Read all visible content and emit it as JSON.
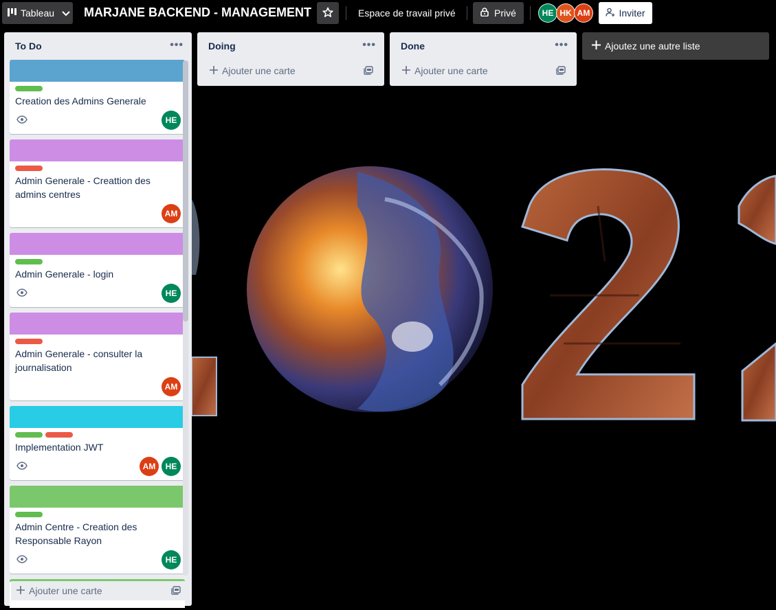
{
  "colors": {
    "avatar_he": "#00875a",
    "avatar_hk": "#e0541c",
    "avatar_am": "#dc3f14",
    "label_green": "#61bd4f",
    "label_red": "#eb5a46",
    "cover_blue": "#5ba4cf",
    "cover_purple": "#cd8de5",
    "cover_sky": "#29cce5",
    "cover_green": "#7bc86c"
  },
  "header": {
    "board_switcher_label": "Tableau",
    "board_title": "MARJANE BACKEND - MANAGEMENT",
    "workspace_label": "Espace de travail privé",
    "visibility_label": "Privé",
    "members": [
      "HE",
      "HK",
      "AM"
    ],
    "invite_label": "Inviter"
  },
  "lists": [
    {
      "title": "To Do",
      "add_card_label": "Ajouter une carte",
      "cards": [
        {
          "cover": "cover_blue",
          "labels": [
            "label_green"
          ],
          "title": "Creation des Admins Generale",
          "watch": true,
          "members": [
            "HE"
          ]
        },
        {
          "cover": "cover_purple",
          "labels": [
            "label_red"
          ],
          "title": "Admin Generale - Creattion des admins centres",
          "watch": false,
          "members": [
            "AM"
          ]
        },
        {
          "cover": "cover_purple",
          "labels": [
            "label_green"
          ],
          "title": "Admin Generale - login",
          "watch": true,
          "members": [
            "HE"
          ]
        },
        {
          "cover": "cover_purple",
          "labels": [
            "label_red"
          ],
          "title": "Admin Generale - consulter la journalisation",
          "watch": false,
          "members": [
            "AM"
          ]
        },
        {
          "cover": "cover_sky",
          "labels": [
            "label_green",
            "label_red"
          ],
          "title": "Implementation JWT",
          "watch": true,
          "members": [
            "AM",
            "HE"
          ]
        },
        {
          "cover": "cover_green",
          "labels": [
            "label_green"
          ],
          "title": "Admin Centre - Creation des Responsable Rayon",
          "watch": true,
          "members": [
            "HE"
          ]
        }
      ]
    },
    {
      "title": "Doing",
      "add_card_label": "Ajouter une carte",
      "cards": []
    },
    {
      "title": "Done",
      "add_card_label": "Ajouter une carte",
      "cards": []
    }
  ],
  "add_list_label": "Ajoutez une autre liste",
  "icons": {
    "board": "board-icon",
    "chevron": "chevron-down-icon",
    "star": "star-icon",
    "lock": "lock-icon",
    "invite": "add-person-icon",
    "menu": "more-horizontal-icon",
    "plus": "plus-icon",
    "template": "card-template-icon",
    "watch": "eye-icon"
  }
}
